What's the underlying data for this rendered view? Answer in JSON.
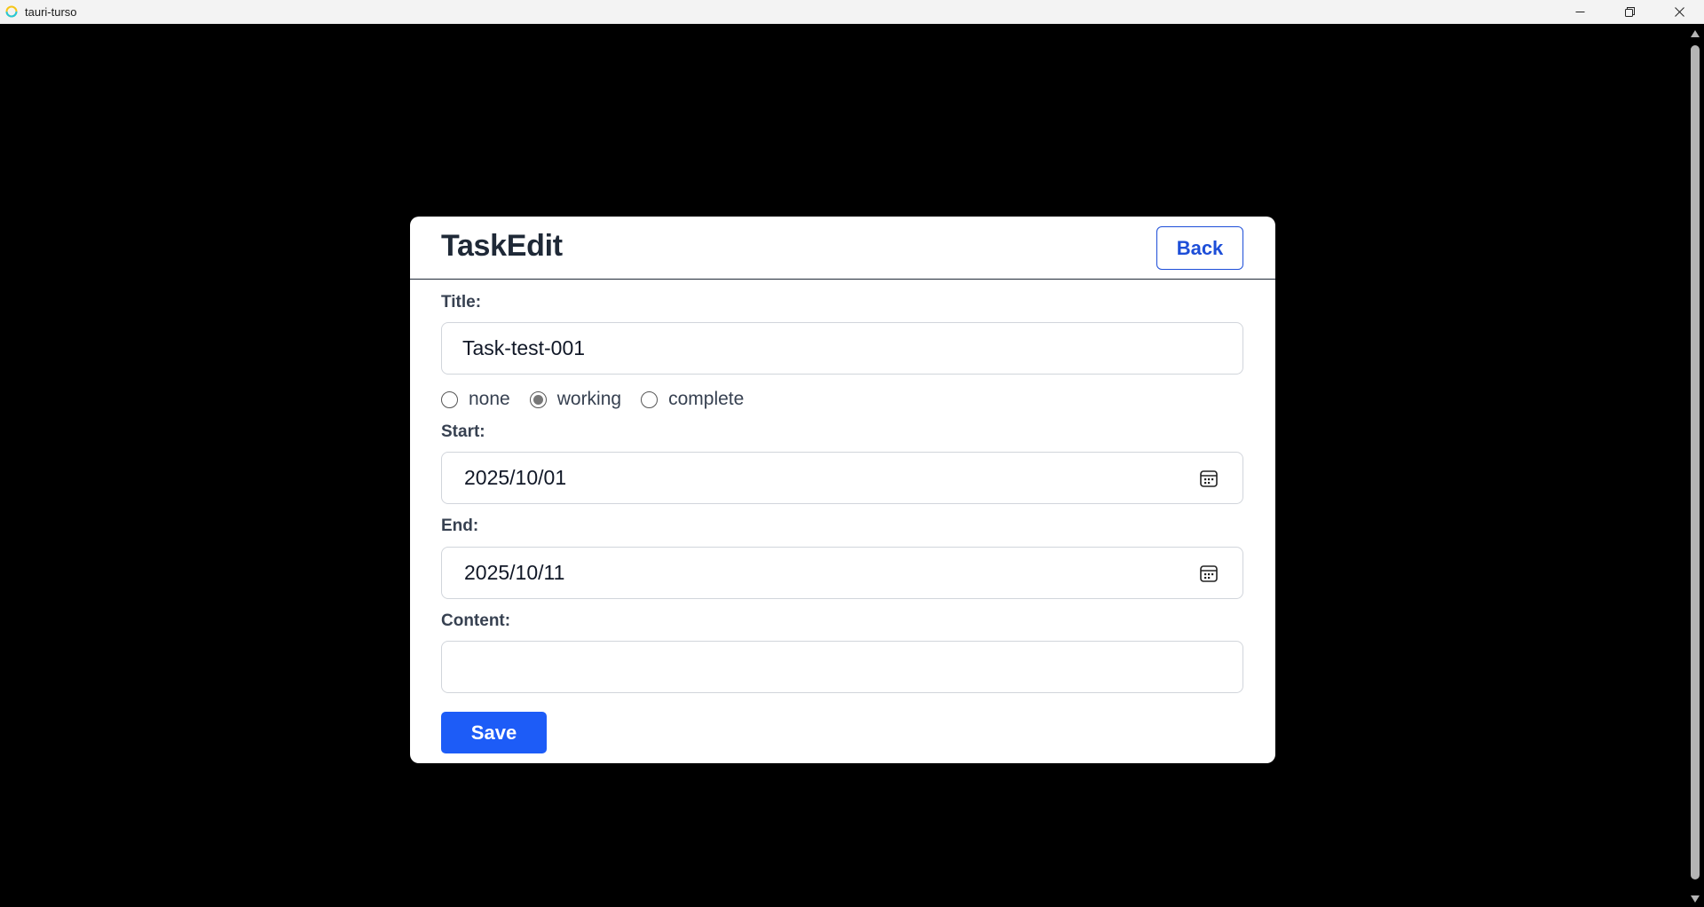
{
  "window": {
    "title": "tauri-turso",
    "controls": [
      "minimize-icon",
      "restore-icon",
      "close-icon"
    ]
  },
  "card": {
    "title": "TaskEdit",
    "back_label": "Back"
  },
  "form": {
    "title_label": "Title:",
    "title_value": "Task-test-001",
    "status_options": [
      {
        "label": "none",
        "selected": false
      },
      {
        "label": "working",
        "selected": true
      },
      {
        "label": "complete",
        "selected": false
      }
    ],
    "start_label": "Start:",
    "start_value": "2025/10/01",
    "end_label": "End:",
    "end_value": "2025/10/11",
    "content_label": "Content:",
    "content_value": "",
    "save_label": "Save"
  },
  "colors": {
    "accent": "#1d5cf7",
    "back_border": "#1d4ed8",
    "background": "#000000"
  }
}
